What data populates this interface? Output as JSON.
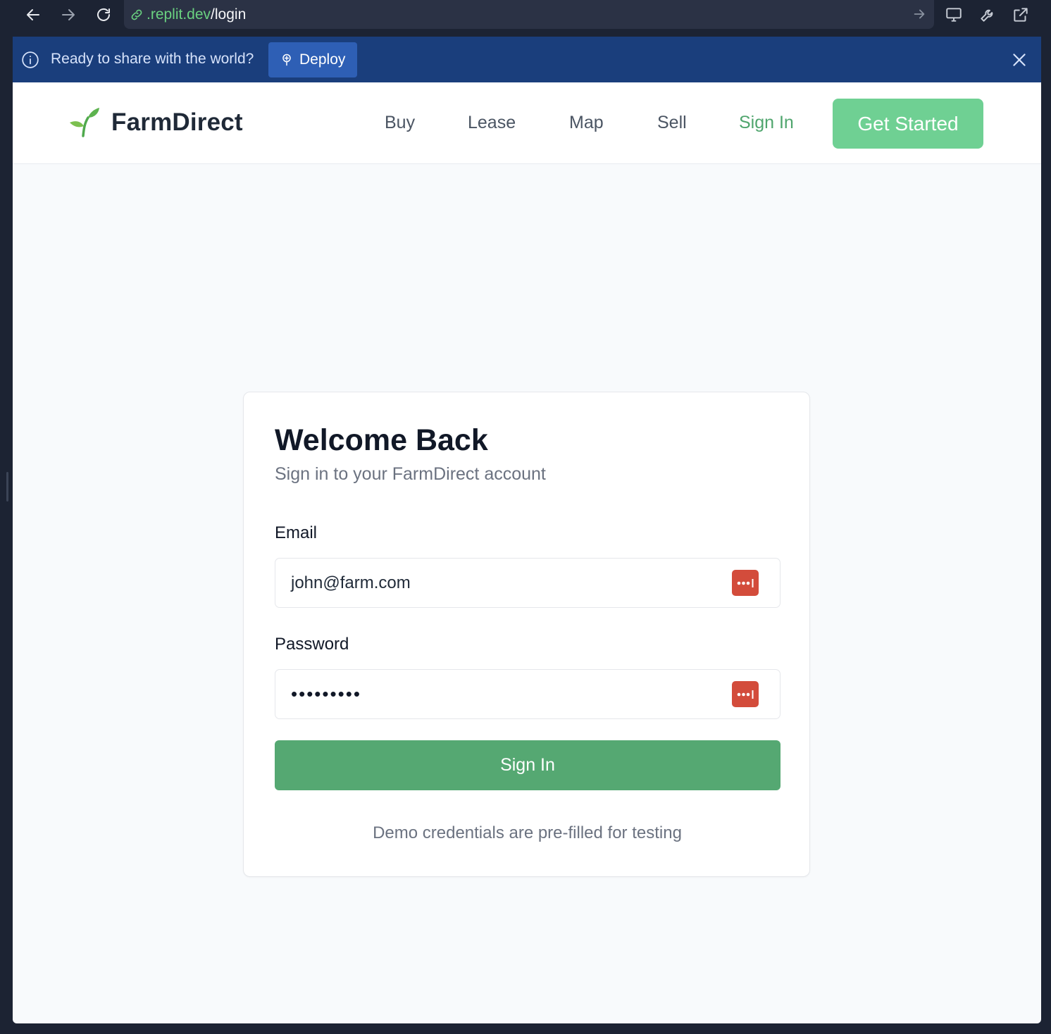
{
  "browser": {
    "url_host": ".replit.dev",
    "url_path": "/login"
  },
  "banner": {
    "message": "Ready to share with the world?",
    "deploy_label": "Deploy"
  },
  "header": {
    "brand": "FarmDirect",
    "nav": [
      "Buy",
      "Lease",
      "Map",
      "Sell"
    ],
    "signin_label": "Sign In",
    "cta_label": "Get Started"
  },
  "login": {
    "title": "Welcome Back",
    "subtitle": "Sign in to your FarmDirect account",
    "email_label": "Email",
    "email_value": "john@farm.com",
    "password_label": "Password",
    "password_mask": "•••••••••",
    "submit_label": "Sign In",
    "note": "Demo credentials are pre-filled for testing"
  },
  "colors": {
    "brand_green": "#55a872",
    "cta_green": "#6fd093",
    "banner_blue": "#1a3e7c",
    "password_manager_red": "#d34c3b"
  },
  "icons": [
    "back-arrow-icon",
    "forward-arrow-icon",
    "reload-icon",
    "link-icon",
    "go-arrow-icon",
    "monitor-icon",
    "wrench-icon",
    "external-link-icon",
    "info-icon",
    "deploy-icon",
    "close-icon",
    "sprout-icon",
    "password-manager-icon"
  ]
}
